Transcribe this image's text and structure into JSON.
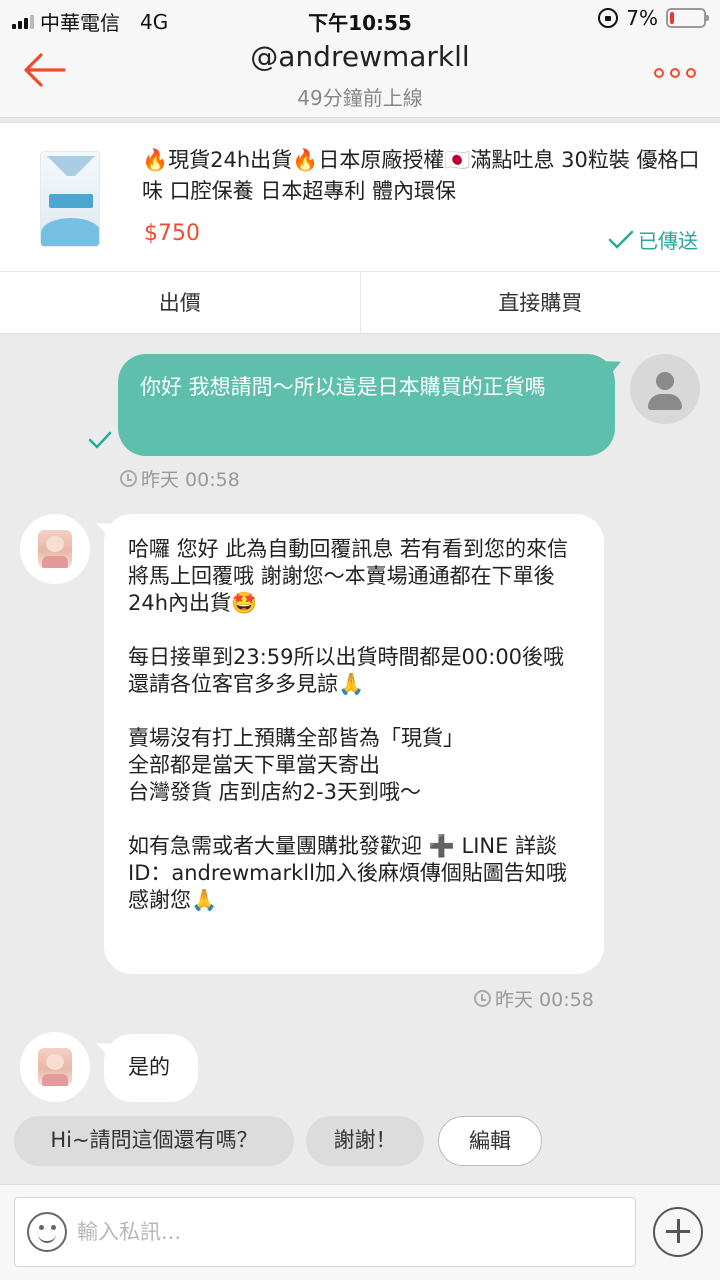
{
  "status_bar": {
    "carrier": "中華電信",
    "network": "4G",
    "time": "下午10:55",
    "battery": "7%"
  },
  "header": {
    "title": "@andrewmarkll",
    "subtitle": "49分鐘前上線"
  },
  "product": {
    "name": "🔥現貨24h出貨🔥日本原廠授權🇯🇵滿點吐息 30粒裝 優格口味 口腔保養 日本超專利 體內環保",
    "price": "$750",
    "sent_label": "已傳送",
    "offer_label": "出價",
    "buy_label": "直接購買"
  },
  "messages": [
    {
      "from": "me",
      "text": "你好 我想請問～所以這是日本購買的正貨嗎",
      "time": "昨天 00:58"
    },
    {
      "from": "seller",
      "paragraphs": [
        "哈囉 您好 此為自動回覆訊息 若有看到您的來信將馬上回覆哦 謝謝您～本賣場通通都在下單後24h內出貨🤩",
        "每日接單到23:59所以出貨時間都是00:00後哦\n還請各位客官多多見諒🙏",
        "賣場沒有打上預購全部皆為「現貨」\n全部都是當天下單當天寄出\n台灣發貨 店到店約2-3天到哦～",
        "如有急需或者大量團購批發歡迎 ➕ LINE 詳談 ID：andrewmarkll加入後麻煩傳個貼圖告知哦 感謝您🙏"
      ],
      "time": "昨天 00:58"
    },
    {
      "from": "seller",
      "text": "是的"
    }
  ],
  "quick_replies": [
    "Hi~請問這個還有嗎？",
    "謝謝！",
    "編輯"
  ],
  "input": {
    "placeholder": "輸入私訊..."
  },
  "colors": {
    "brand": "#ee4d2d",
    "bubble_out": "#5ebfac",
    "sent_green": "#26aa99"
  }
}
